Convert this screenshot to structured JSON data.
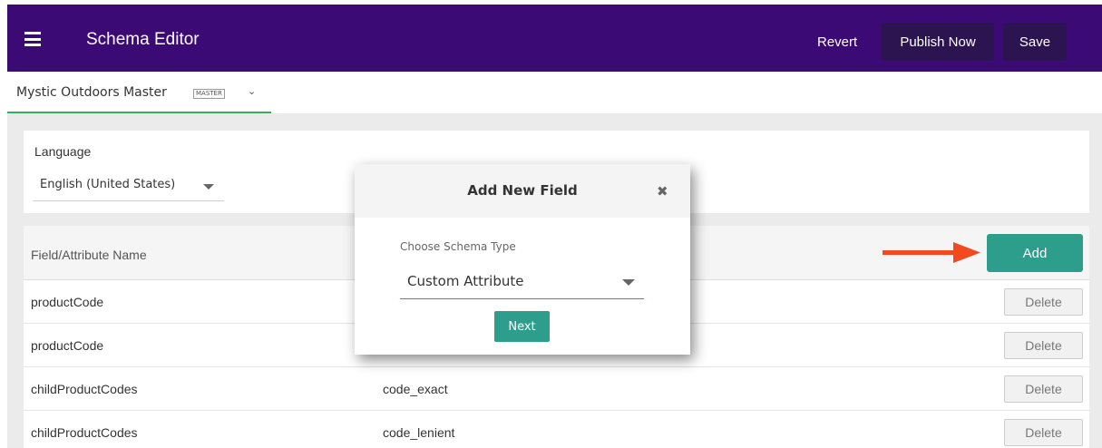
{
  "header": {
    "title": "Schema Editor",
    "revert_label": "Revert",
    "publish_label": "Publish Now",
    "save_label": "Save"
  },
  "account": {
    "name": "Mystic Outdoors Master",
    "badge": "MASTER"
  },
  "language": {
    "label": "Language",
    "selected": "English (United States)"
  },
  "table": {
    "column_name": "Field/Attribute Name",
    "add_label": "Add",
    "delete_label": "Delete",
    "rows": [
      {
        "name": "productCode",
        "type": ""
      },
      {
        "name": "productCode",
        "type": ""
      },
      {
        "name": "childProductCodes",
        "type": "code_exact"
      },
      {
        "name": "childProductCodes",
        "type": "code_lenient"
      }
    ]
  },
  "modal": {
    "title": "Add New Field",
    "schema_label": "Choose Schema Type",
    "schema_selected": "Custom Attribute",
    "next_label": "Next"
  },
  "colors": {
    "header_bg": "#3b0a74",
    "accent": "#2e9e8c",
    "arrow": "#f04a1e",
    "tab_underline": "#3aaa5c"
  }
}
